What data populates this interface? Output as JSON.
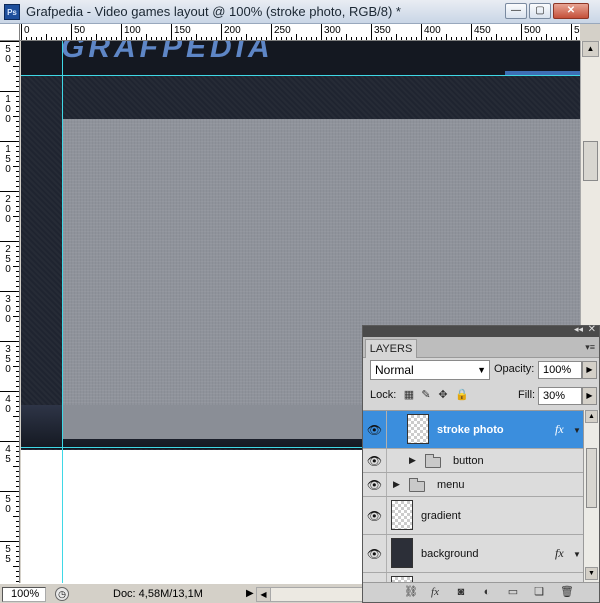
{
  "window": {
    "app_icon": "Ps",
    "title": "Grafpedia - Video games layout @ 100% (stroke photo, RGB/8) *",
    "minimize": "—",
    "maximize": "▢",
    "close": "✕"
  },
  "ruler": {
    "h_labels": [
      "0",
      "50",
      "100",
      "150",
      "200",
      "250",
      "300",
      "350",
      "400",
      "450",
      "500",
      "5"
    ],
    "v_labels": [
      "5\n0",
      "1\n0\n0",
      "1\n5\n0",
      "2\n0\n0",
      "2\n5\n0",
      "3\n0\n0",
      "3\n5\n0",
      "4\n0",
      "4\n5",
      "5\n0",
      "5\n5"
    ]
  },
  "status": {
    "zoom": "100%",
    "doc": "Doc: 4,58M/13,1M"
  },
  "layers_panel": {
    "tab": "LAYERS",
    "blend_mode": "Normal",
    "opacity_label": "Opacity:",
    "opacity": "100%",
    "lock_label": "Lock:",
    "fill_label": "Fill:",
    "fill": "30%",
    "layers": [
      {
        "name": "stroke photo",
        "selected": true,
        "fx": "fx"
      },
      {
        "name": "button",
        "type": "group"
      },
      {
        "name": "menu",
        "type": "group"
      },
      {
        "name": "gradient"
      },
      {
        "name": "background",
        "fx": "fx"
      }
    ]
  },
  "colors": {
    "selection": "#3b8edd",
    "guide": "#3fd8e6"
  }
}
